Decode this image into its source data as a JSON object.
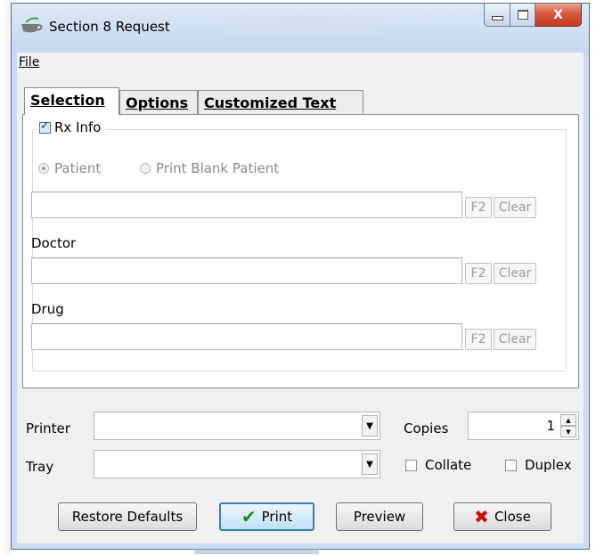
{
  "window": {
    "title": "Section 8 Request",
    "controls": {
      "minimize": "–",
      "maximize": "□",
      "close": "X"
    }
  },
  "menu": {
    "file": "File"
  },
  "tabs": [
    {
      "label": "Selection",
      "active": true
    },
    {
      "label": "Options",
      "active": false
    },
    {
      "label": "Customized Text",
      "active": false
    }
  ],
  "rx_info": {
    "label": "Rx Info",
    "checked": true,
    "radios": [
      {
        "label": "Patient",
        "selected": true
      },
      {
        "label": "Print Blank Patient",
        "selected": false
      }
    ],
    "patient": {
      "value": "",
      "f2": "F2",
      "clear": "Clear"
    },
    "doctor": {
      "label": "Doctor",
      "value": "",
      "f2": "F2",
      "clear": "Clear"
    },
    "drug": {
      "label": "Drug",
      "value": "",
      "f2": "F2",
      "clear": "Clear"
    }
  },
  "print_settings": {
    "printer_label": "Printer",
    "printer_value": "",
    "tray_label": "Tray",
    "tray_value": "",
    "copies_label": "Copies",
    "copies_value": "1",
    "collate_label": "Collate",
    "collate_checked": false,
    "duplex_label": "Duplex",
    "duplex_checked": false
  },
  "buttons": {
    "restore": "Restore Defaults",
    "print": "Print",
    "preview": "Preview",
    "close": "Close"
  },
  "icons": {
    "app": "teacup-icon",
    "print": "check-icon",
    "close": "x-icon"
  },
  "colors": {
    "titlebar": "#c6d8ee",
    "close_button": "#c23a1f",
    "default_button_border": "#3c7fb1"
  }
}
